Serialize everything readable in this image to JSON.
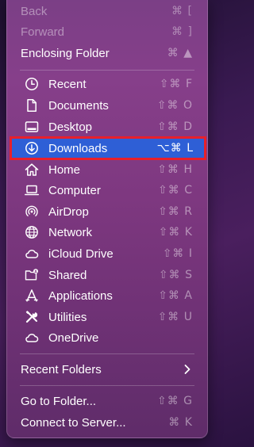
{
  "menu": {
    "nav": [
      {
        "label": "Back",
        "shortcut": "⌘ [",
        "enabled": false
      },
      {
        "label": "Forward",
        "shortcut": "⌘ ]",
        "enabled": false
      },
      {
        "label": "Enclosing Folder",
        "shortcut": "⌘ ▲",
        "enabled": true
      }
    ],
    "places": [
      {
        "label": "Recent",
        "shortcut": "⇧⌘ F",
        "icon": "clock-icon"
      },
      {
        "label": "Documents",
        "shortcut": "⇧⌘ O",
        "icon": "document-icon"
      },
      {
        "label": "Desktop",
        "shortcut": "⇧⌘ D",
        "icon": "desktop-icon"
      },
      {
        "label": "Downloads",
        "shortcut": "⌥⌘ L",
        "icon": "download-icon",
        "highlighted": true
      },
      {
        "label": "Home",
        "shortcut": "⇧⌘ H",
        "icon": "home-icon"
      },
      {
        "label": "Computer",
        "shortcut": "⇧⌘ C",
        "icon": "laptop-icon"
      },
      {
        "label": "AirDrop",
        "shortcut": "⇧⌘ R",
        "icon": "airdrop-icon"
      },
      {
        "label": "Network",
        "shortcut": "⇧⌘ K",
        "icon": "globe-icon"
      },
      {
        "label": "iCloud Drive",
        "shortcut": "⇧⌘ I",
        "icon": "cloud-icon"
      },
      {
        "label": "Shared",
        "shortcut": "⇧⌘ S",
        "icon": "shared-folder-icon"
      },
      {
        "label": "Applications",
        "shortcut": "⇧⌘ A",
        "icon": "applications-icon"
      },
      {
        "label": "Utilities",
        "shortcut": "⇧⌘ U",
        "icon": "tools-icon"
      },
      {
        "label": "OneDrive",
        "shortcut": "",
        "icon": "cloud-icon"
      }
    ],
    "recent_folders": {
      "label": "Recent Folders",
      "submenu_icon": "chevron-right-icon"
    },
    "footer": [
      {
        "label": "Go to Folder...",
        "shortcut": "⇧⌘ G"
      },
      {
        "label": "Connect to Server...",
        "shortcut": "⌘ K"
      }
    ]
  },
  "colors": {
    "highlight": "#2e5fd6",
    "annotation_outline": "#e8202a",
    "menu_background": "#7e3880"
  }
}
